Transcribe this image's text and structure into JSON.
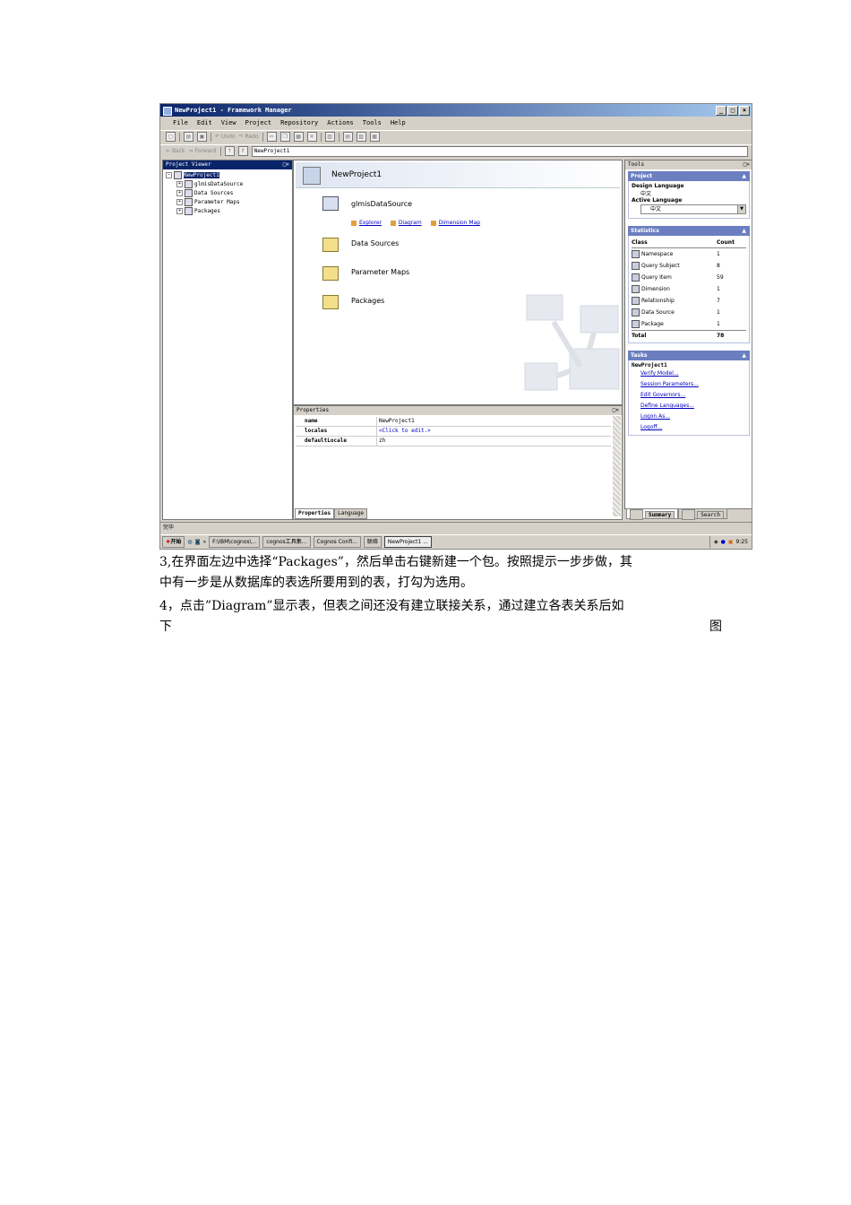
{
  "window": {
    "title": "NewProject1 - Framework Manager",
    "controls": [
      "_",
      "□",
      "×"
    ]
  },
  "menu": [
    "File",
    "Edit",
    "View",
    "Project",
    "Repository",
    "Actions",
    "Tools",
    "Help"
  ],
  "toolbar": {
    "undo_label": "Undo",
    "redo_label": "Redo",
    "back_label": "Back",
    "forward_label": "Forward",
    "address": "NewProject1"
  },
  "project_viewer": {
    "title": "Project Viewer",
    "pane_controls": "□×",
    "items": [
      {
        "label": "NewProject1",
        "selected": true
      },
      {
        "label": "glmisDataSource"
      },
      {
        "label": "Data Sources"
      },
      {
        "label": "Parameter Maps"
      },
      {
        "label": "Packages"
      }
    ]
  },
  "main": {
    "header": "NewProject1",
    "datasource": "glmisDataSource",
    "links": [
      "Explorer",
      "Diagram",
      "Dimension Map"
    ],
    "folders": [
      "Data Sources",
      "Parameter Maps",
      "Packages"
    ]
  },
  "properties": {
    "title": "Properties",
    "pane_controls": "□×",
    "rows": [
      {
        "key": "name",
        "value": "NewProject1"
      },
      {
        "key": "locales",
        "value": "<Click to edit.>"
      },
      {
        "key": "defaultLocale",
        "value": "zh"
      }
    ],
    "tabs": [
      "Properties",
      "Language"
    ]
  },
  "tools": {
    "title": "Tools",
    "pane_controls": "□×",
    "project_section": {
      "title": "Project",
      "design_language_label": "Design Language",
      "design_language_value": "中文",
      "active_language_label": "Active Language",
      "active_language_value": "中文"
    },
    "statistics": {
      "title": "Statistics",
      "class_header": "Class",
      "count_header": "Count",
      "rows": [
        {
          "class": "Namespace",
          "count": "1"
        },
        {
          "class": "Query Subject",
          "count": "8"
        },
        {
          "class": "Query Item",
          "count": "59"
        },
        {
          "class": "Dimension",
          "count": "1"
        },
        {
          "class": "Relationship",
          "count": "7"
        },
        {
          "class": "Data Source",
          "count": "1"
        },
        {
          "class": "Package",
          "count": "1"
        }
      ],
      "total_label": "Total",
      "total_value": "78"
    },
    "tasks": {
      "title": "Tasks",
      "project": "NewProject1",
      "links": [
        "Verify Model...",
        "Session Parameters...",
        "Edit Governors...",
        "Define Languages...",
        "Logon As...",
        "Logoff..."
      ]
    },
    "tabs": [
      "Summary",
      "Search"
    ]
  },
  "status_bar": {
    "text": "完毕"
  },
  "taskbar": {
    "start": "开始",
    "items": [
      "F:\\IBM\\cognos\\...",
      "cognos工具集...",
      "Cognos Confi...",
      "联络",
      "NewProject1 ..."
    ],
    "clock": "9:25"
  },
  "document": {
    "line1": "3,在界面左边中选择“Packages”，然后单击右键新建一个包。按照提示一步步做，其",
    "line2": "中有一步是从数据库的表选所要用到的表，打勾为选用。",
    "line3": "4，点击”Diagram”显示表，但表之间还没有建立联接关系，通过建立各表关系后如",
    "line4_left": "下",
    "line4_right": "图"
  }
}
